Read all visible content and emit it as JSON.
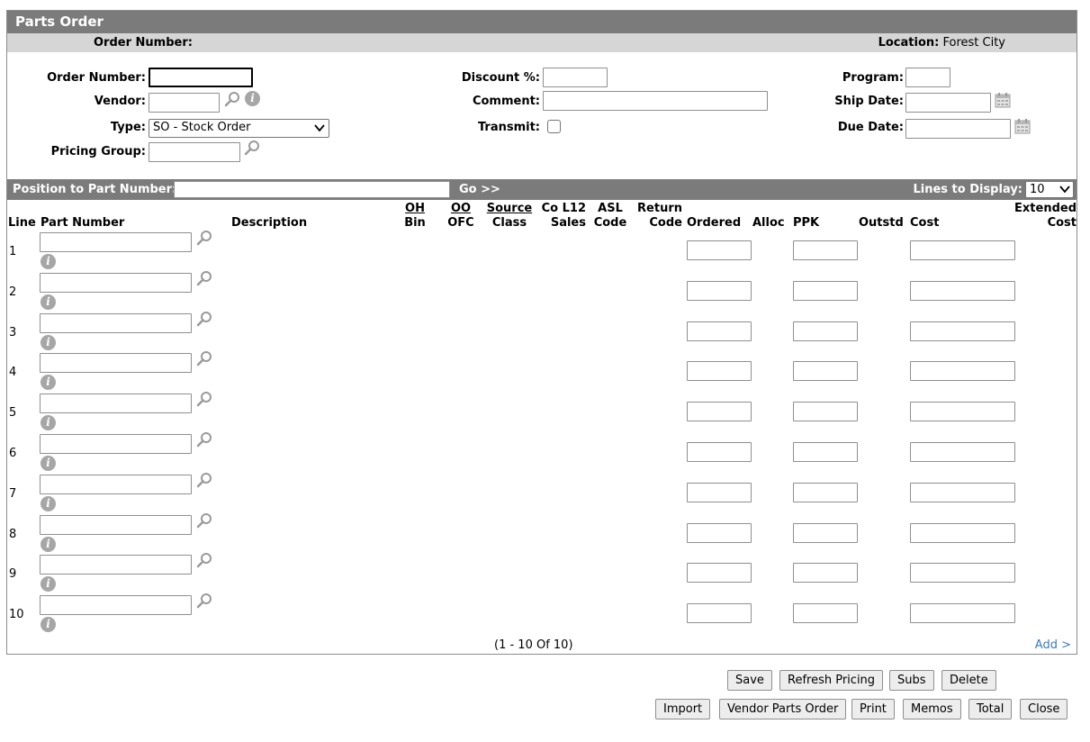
{
  "title": "Parts Order",
  "info": {
    "order_number_label": "Order Number:",
    "location_label": "Location:",
    "location_value": "Forest City"
  },
  "form": {
    "order_number_label": "Order Number:",
    "vendor_label": "Vendor:",
    "type_label": "Type:",
    "type_value": "SO - Stock Order",
    "pricing_group_label": "Pricing Group:",
    "discount_label": "Discount %:",
    "comment_label": "Comment:",
    "transmit_label": "Transmit:",
    "program_label": "Program:",
    "ship_date_label": "Ship Date:",
    "due_date_label": "Due Date:"
  },
  "position_bar": {
    "label": "Position to Part Number:",
    "go": "Go >>",
    "lines_label": "Lines to Display:",
    "lines_value": "10"
  },
  "columns": {
    "line": "Line",
    "part_number": "Part Number",
    "description": "Description",
    "oh": "OH",
    "bin": "Bin",
    "oo": "OO",
    "ofc": "OFC",
    "source": "Source",
    "class": "Class",
    "co_l12": "Co L12",
    "sales": "Sales",
    "asl": "ASL",
    "code": "Code",
    "return": "Return",
    "return_code": "Code",
    "ordered": "Ordered",
    "alloc": "Alloc",
    "ppk": "PPK",
    "outstd": "Outstd",
    "cost": "Cost",
    "extended": "Extended",
    "ext_cost": "Cost"
  },
  "rows": [
    "1",
    "2",
    "3",
    "4",
    "5",
    "6",
    "7",
    "8",
    "9",
    "10"
  ],
  "pager": "(1  -  10  Of  10)",
  "add_link": "Add >",
  "buttons": {
    "save": "Save",
    "refresh_pricing": "Refresh Pricing",
    "subs": "Subs",
    "delete": "Delete",
    "import": "Import",
    "vendor_parts_order": "Vendor Parts Order",
    "print": "Print",
    "memos": "Memos",
    "total": "Total",
    "close": "Close"
  },
  "icons": {
    "search": "magnifier-icon",
    "info": "info-icon",
    "calendar": "calendar-icon"
  }
}
